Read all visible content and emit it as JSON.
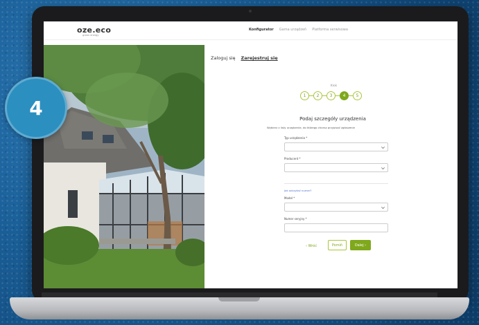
{
  "badge": {
    "number": "4"
  },
  "header": {
    "logo": "oze.eco",
    "logo_sub": "green energy",
    "nav": [
      "Konfigurator",
      "Gama urządzeń",
      "Platforma serwisowa"
    ],
    "active_nav": "Konfigurator"
  },
  "auth": {
    "login": "Zaloguj się",
    "register": "Zarejestruj się"
  },
  "stepper": {
    "label": "Krok",
    "steps": [
      "1",
      "2",
      "3",
      "4",
      "5"
    ],
    "current": 4
  },
  "form": {
    "title": "Podaj szczegóły urządzenia",
    "description": "Wybierz z listy urządzenie, do którego chcesz przypisać zgłoszenie",
    "fields": [
      {
        "label": "Typ urządzenia *",
        "value": "",
        "type": "select"
      },
      {
        "label": "Producent *",
        "value": "",
        "type": "select"
      },
      {
        "label": "Model *",
        "value": "",
        "type": "select"
      },
      {
        "label": "Numer seryjny *",
        "value": "",
        "type": "text"
      }
    ],
    "link": "Jak odczytać numer?",
    "back": "‹ Wróć",
    "skip": "Pomiń",
    "next": "Dalej ›"
  },
  "colors": {
    "accent": "#7fa81c",
    "badge": "#2b8fc0",
    "link": "#4a6fd0"
  }
}
